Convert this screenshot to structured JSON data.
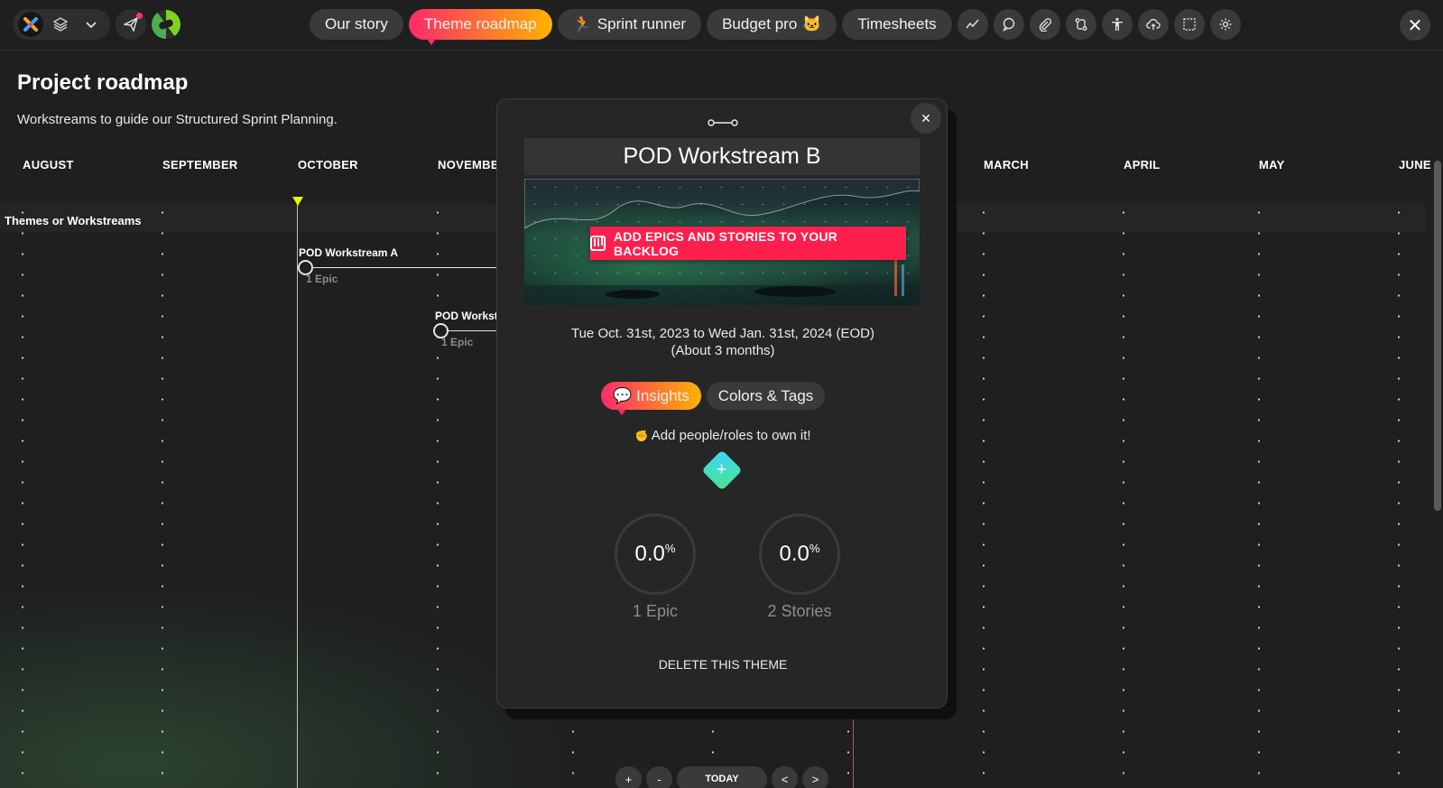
{
  "topbar": {
    "nav_tabs": [
      {
        "label": "Our story",
        "icon": ""
      },
      {
        "label": "Theme roadmap",
        "icon": ""
      },
      {
        "label": "Sprint runner",
        "icon": "🏃"
      },
      {
        "label": "Budget pro",
        "icon": "🐱"
      },
      {
        "label": "Timesheets",
        "icon": ""
      }
    ],
    "toolbar_icons": [
      "trend-icon",
      "chat-icon",
      "paperclip-icon",
      "swap-icon",
      "accessibility-icon",
      "cloud-upload-icon",
      "selection-icon",
      "settings-icon"
    ],
    "close_glyph": "✕"
  },
  "page": {
    "title": "Project roadmap",
    "subtitle": "Workstreams to guide our Structured Sprint Planning."
  },
  "timeline": {
    "months": [
      "AUGUST",
      "SEPTEMBER",
      "OCTOBER",
      "NOVEMBE",
      "MARCH",
      "APRIL",
      "MAY",
      "JUNE"
    ],
    "row_header": "Themes or Workstreams",
    "workstreams": [
      {
        "name": "POD Workstream A",
        "sub": "1 Epic"
      },
      {
        "name": "POD Workst",
        "sub": "1 Epic"
      }
    ],
    "zoom": {
      "plus": "+",
      "minus": "-",
      "today": "TODAY",
      "prev": "<",
      "next": ">"
    }
  },
  "modal": {
    "title": "POD Workstream B",
    "backlog_button": "ADD EPICS AND STORIES TO YOUR BACKLOG",
    "date_range": "Tue Oct. 31st, 2023 to Wed Jan. 31st, 2024 (EOD)",
    "duration": "(About 3 months)",
    "tabs": [
      {
        "label": "Insights",
        "icon": "💬"
      },
      {
        "label": "Colors & Tags",
        "icon": ""
      }
    ],
    "owner_prompt": "Add people/roles to own it!",
    "owner_icon": "✊",
    "add_glyph": "+",
    "stats": [
      {
        "value": "0.0",
        "unit": "%",
        "label": "1 Epic"
      },
      {
        "value": "0.0",
        "unit": "%",
        "label": "2 Stories"
      }
    ],
    "delete_label": "DELETE THIS THEME",
    "close_glyph": "✕",
    "handle_glyph": "o—o"
  },
  "colors": {
    "accent_pink": "#ff2a6d",
    "accent_yellow": "#ffb300",
    "today_line": "#e5ff00",
    "backlog_red": "#ff1f4d"
  }
}
